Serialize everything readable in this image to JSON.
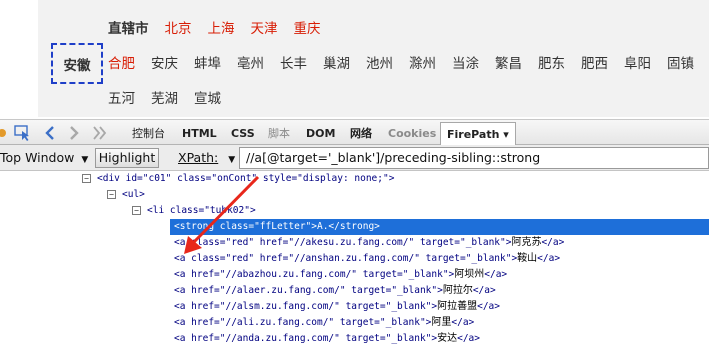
{
  "page": {
    "municipality_label": "直辖市",
    "municipalities": [
      "北京",
      "上海",
      "天津",
      "重庆"
    ],
    "province": "安徽",
    "cities_row1": [
      "合肥",
      "安庆",
      "蚌埠",
      "亳州",
      "长丰",
      "巢湖",
      "池州",
      "滁州",
      "当涂",
      "繁昌",
      "肥东",
      "肥西",
      "阜阳",
      "固镇"
    ],
    "cities_row2": [
      "五河",
      "芜湖",
      "宣城"
    ]
  },
  "toolbar": {
    "tabs": [
      "控制台",
      "HTML",
      "CSS",
      "脚本",
      "DOM",
      "网络",
      "Cookies"
    ],
    "active_tab": "FirePath",
    "active_tab_arrow": "▾"
  },
  "firepath": {
    "frame_select": "Top Window",
    "highlight": "Highlight",
    "xpath_label": "XPath:",
    "xpath_value": "//a[@target='_blank']/preceding-sibling::strong"
  },
  "tree": {
    "div_open": "<div  id=\"c01\"  class=\"onCont\"  style=\"display: none;\">",
    "ul_open": "<ul>",
    "li_open": "<li  class=\"tubk02\">",
    "strong_line": "<strong  class=\"ffLetter\">A.</strong>",
    "links": [
      {
        "pre": "<a  class=\"red\"  href=\"//akesu.zu.fang.com/\"  target=\"_blank\">",
        "city": "阿克苏",
        "post": "</a>"
      },
      {
        "pre": "<a  class=\"red\"  href=\"//anshan.zu.fang.com/\"  target=\"_blank\">",
        "city": "鞍山",
        "post": "</a>"
      },
      {
        "pre": "<a  href=\"//abazhou.zu.fang.com/\"  target=\"_blank\">",
        "city": "阿坝州",
        "post": "</a>"
      },
      {
        "pre": "<a  href=\"//alaer.zu.fang.com/\"  target=\"_blank\">",
        "city": "阿拉尔",
        "post": "</a>"
      },
      {
        "pre": "<a  href=\"//alsm.zu.fang.com/\"  target=\"_blank\">",
        "city": "阿拉善盟",
        "post": "</a>"
      },
      {
        "pre": "<a  href=\"//ali.zu.fang.com/\"  target=\"_blank\">",
        "city": "阿里",
        "post": "</a>"
      },
      {
        "pre": "<a  href=\"//anda.zu.fang.com/\"  target=\"_blank\">",
        "city": "安达",
        "post": "</a>"
      }
    ]
  },
  "colors": {
    "accent_red": "#d81e06",
    "selection_blue": "#1e6fd9",
    "annotation_arrow": "#e8271b"
  }
}
